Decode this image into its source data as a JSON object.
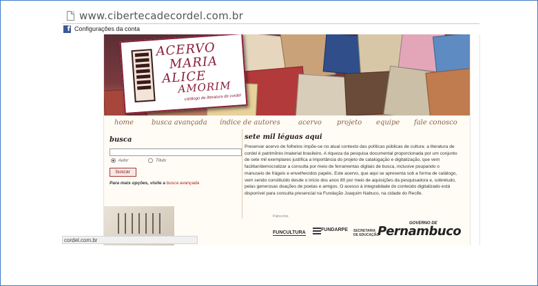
{
  "browser": {
    "url": "www.cibertecadecordel.com.br",
    "bookmark_label": "Configurações da conta",
    "status_text": "cordel.com.br"
  },
  "logo": {
    "line1": "ACERVO",
    "line2": "MARIA",
    "line3": "ALICE",
    "line4": "AMORIM",
    "subtitle": "catálogo de literatura de cordel"
  },
  "nav": {
    "items": [
      "home",
      "busca avançada",
      "índice de autores",
      "acervo",
      "projeto",
      "equipe",
      "fale conosco"
    ]
  },
  "search": {
    "title": "busca",
    "input_value": "",
    "option_author": "Autor",
    "option_title": "Título",
    "selected": "Autor",
    "button_label": "buscar",
    "advanced_prefix": "Para mais opções, visite a",
    "advanced_link": "busca avançada"
  },
  "intro": {
    "title": "sete mil léguas aqui",
    "body": "Preservar acervo de folhetos impõe-se no atual contexto das políticas públicas de cultura: a literatura de cordel é patrimônio imaterial brasileiro. A riqueza da pesquisa documental proporcionada por um conjunto de sete mil exemplares justifica a importância do projeto de catalogação e digitalização, que vem facilitar/democratizar a consulta por meio de ferramentas digitais de busca, inclusive poupando o manuseio de frágeis e envelhecidos papéis. Este acervo, que aqui se apresenta sob a forma de catálogo, vem sendo constituído desde o início dos anos 80 por meio de aquisições da pesquisadora e, sobretudo, pelas generosas doações de poetas e amigos. O acesso à integralidade do conteúdo digitalizado está disponível para consulta presencial na Fundação Joaquim Nabuco, na cidade do Recife."
  },
  "sponsors": {
    "label": "Patrocínio",
    "funcultura": "FUNCULTURA",
    "fundarpe": "FUNDARPE",
    "secretaria_line1": "SECRETARIA",
    "secretaria_line2": "DE EDUCAÇÃO",
    "governo": "GOVERNO DE",
    "pernambuco": "Pernambuco"
  },
  "colors": {
    "frame": "#3d79c9",
    "brand": "#8a1d3a",
    "nav": "#8b6246",
    "link": "#b01818"
  }
}
